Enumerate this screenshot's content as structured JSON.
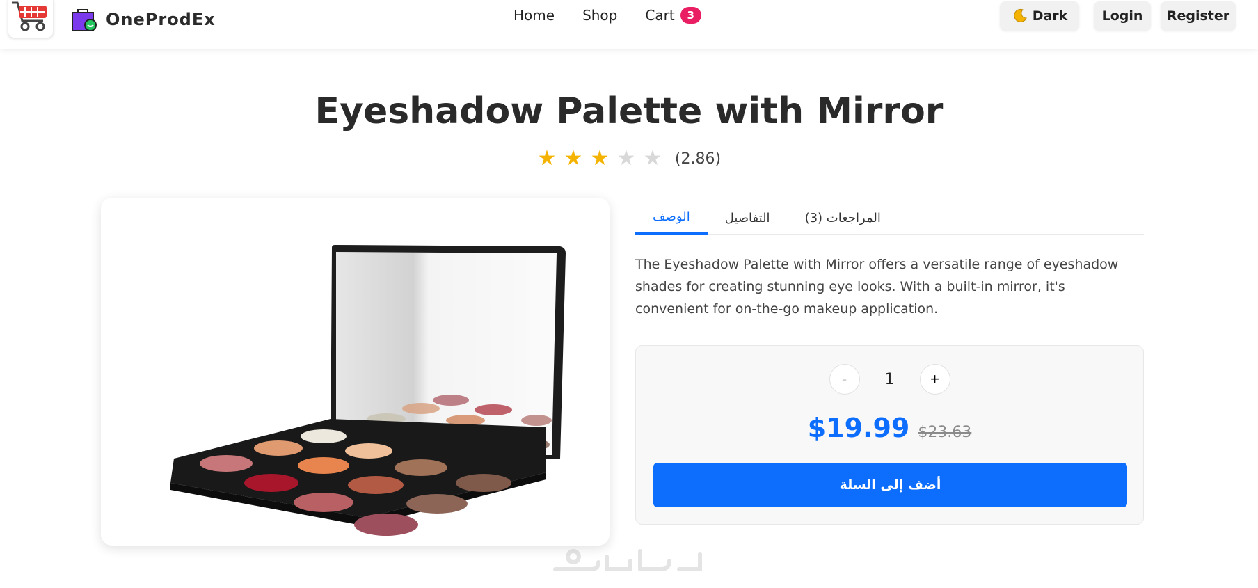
{
  "nav": {
    "brand": "OneProdEx",
    "links": {
      "home": "Home",
      "shop": "Shop",
      "cart": "Cart"
    },
    "cart_count": "3",
    "theme_button": "Dark",
    "login": "Login",
    "register": "Register"
  },
  "product": {
    "title": "Eyeshadow Palette with Mirror",
    "rating": 2.86,
    "rating_text": "(2.86)",
    "image_alt": "Eyeshadow palette with mirror",
    "description": "The Eyeshadow Palette with Mirror offers a versatile range of eyeshadow shades for creating stunning eye looks. With a built-in mirror, it's convenient for on-the-go makeup application.",
    "quantity": "1",
    "price": "$19.99",
    "old_price": "$23.63",
    "add_to_cart": "أضف إلى السلة"
  },
  "tabs": {
    "description": "الوصف",
    "details": "التفاصيل",
    "reviews": "المراجعات (3)"
  },
  "controls": {
    "minus": "-",
    "plus": "+"
  },
  "watermark": "خمسات",
  "colors": {
    "accent": "#0d6efd",
    "badge": "#e91e63",
    "star": "#f5b301",
    "star_empty": "#d8d8d8"
  }
}
